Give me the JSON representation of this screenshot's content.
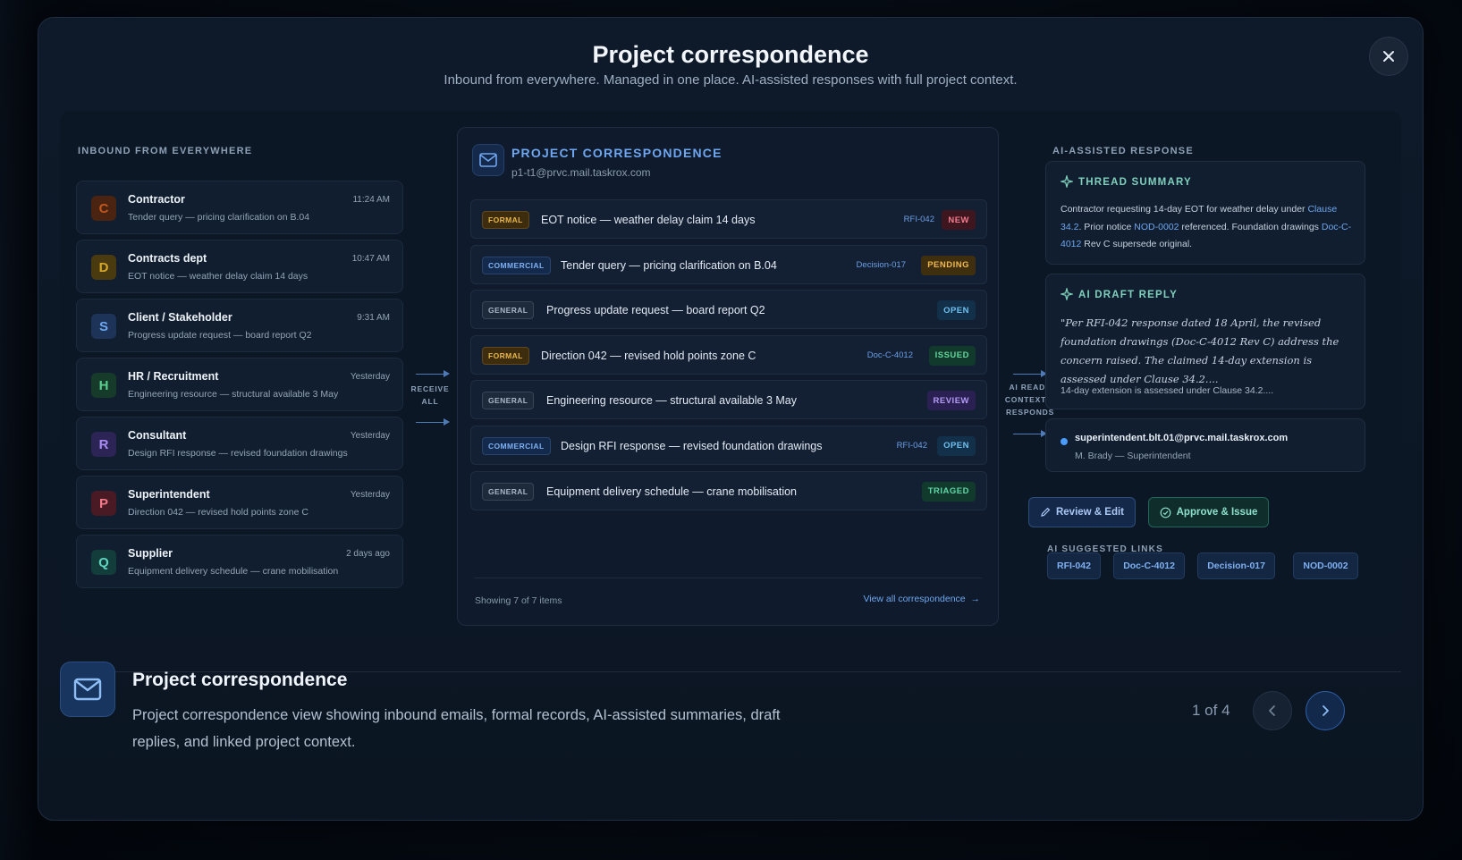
{
  "modal": {
    "title": "Project correspondence",
    "subtitle": "Inbound from everywhere. Managed in one place. AI-assisted responses with full project context."
  },
  "inbound": {
    "label": "INBOUND FROM EVERYWHERE",
    "items": [
      {
        "initial": "C",
        "name": "Contractor",
        "time": "11:24 AM",
        "desc": "Tender query — pricing clarification on B.04",
        "color": "#c2581f",
        "bg": "#4a2410"
      },
      {
        "initial": "D",
        "name": "Contracts dept",
        "time": "10:47 AM",
        "desc": "EOT notice — weather delay claim 14 days",
        "color": "#d6a72a",
        "bg": "#4a3a10"
      },
      {
        "initial": "S",
        "name": "Client / Stakeholder",
        "time": "9:31 AM",
        "desc": "Progress update request — board report Q2",
        "color": "#6ea6ef",
        "bg": "#1d3458"
      },
      {
        "initial": "H",
        "name": "HR / Recruitment",
        "time": "Yesterday",
        "desc": "Engineering resource — structural available 3 May",
        "color": "#5ccf8e",
        "bg": "#173b2b"
      },
      {
        "initial": "R",
        "name": "Consultant",
        "time": "Yesterday",
        "desc": "Design RFI response — revised foundation drawings",
        "color": "#a98cf2",
        "bg": "#2d2456"
      },
      {
        "initial": "P",
        "name": "Superintendent",
        "time": "Yesterday",
        "desc": "Direction 042 — revised hold points zone C",
        "color": "#f27a8a",
        "bg": "#4a1a24"
      },
      {
        "initial": "Q",
        "name": "Supplier",
        "time": "2 days ago",
        "desc": "Equipment delivery schedule — crane mobilisation",
        "color": "#5fd6c2",
        "bg": "#123d3a"
      }
    ]
  },
  "connectors": {
    "receive": "RECEIVE ALL",
    "ai": "AI READS CONTEXT & RESPONDS"
  },
  "center": {
    "title": "PROJECT CORRESPONDENCE",
    "email": "p1-t1@prvc.mail.taskrox.com",
    "rows": [
      {
        "tag": "FORMAL",
        "subject": "EOT notice — weather delay claim 14 days",
        "ref": "RFI-042",
        "status": "NEW"
      },
      {
        "tag": "COMMERCIAL",
        "subject": "Tender query — pricing clarification on B.04",
        "ref": "Decision-017",
        "status": "PENDING"
      },
      {
        "tag": "GENERAL",
        "subject": "Progress update request — board report Q2",
        "ref": "",
        "status": "OPEN"
      },
      {
        "tag": "FORMAL",
        "subject": "Direction 042 — revised hold points zone C",
        "ref": "Doc-C-4012",
        "status": "ISSUED"
      },
      {
        "tag": "GENERAL",
        "subject": "Engineering resource — structural available 3 May",
        "ref": "",
        "status": "REVIEW"
      },
      {
        "tag": "COMMERCIAL",
        "subject": "Design RFI response — revised foundation drawings",
        "ref": "RFI-042",
        "status": "OPEN"
      },
      {
        "tag": "GENERAL",
        "subject": "Equipment delivery schedule — crane mobilisation",
        "ref": "",
        "status": "TRIAGED"
      }
    ],
    "showing": "Showing 7 of 7 items",
    "view_all": "View all correspondence"
  },
  "ai": {
    "label": "AI-ASSISTED RESPONSE",
    "summary_title": "THREAD SUMMARY",
    "summary": {
      "p1": "Contractor requesting 14-day EOT for weather delay under ",
      "l1": "Clause 34.2",
      "p2": ". Prior notice ",
      "l2": "NOD-0002",
      "p3": " referenced. Foundation drawings ",
      "l3": "Doc-C-4012",
      "p4": " Rev C supersede original."
    },
    "draft_title": "AI DRAFT REPLY",
    "draft_text": "\"Per RFI-042 response dated 18 April, the revised foundation drawings (Doc-C-4012 Rev C) address the concern raised. The claimed 14-day extension is assessed under Clause 34.2....",
    "draft_extra": "14-day extension is assessed under Clause 34.2....",
    "recipient_email": "superintendent.blt.01@prvc.mail.taskrox.com",
    "recipient_name": "M. Brady — Superintendent",
    "review_label": "Review & Edit",
    "approve_label": "Approve & Issue",
    "links_label": "AI SUGGESTED LINKS",
    "links": [
      "RFI-042",
      "Doc-C-4012",
      "Decision-017",
      "NOD-0002"
    ]
  },
  "footer": {
    "title": "Project correspondence",
    "desc": "Project correspondence view showing inbound emails, formal records, AI-assisted summaries, draft replies, and linked project context.",
    "pager": "1 of 4"
  },
  "colors": {
    "accent": "#6ea6ef",
    "teal": "#7fd0bd"
  }
}
